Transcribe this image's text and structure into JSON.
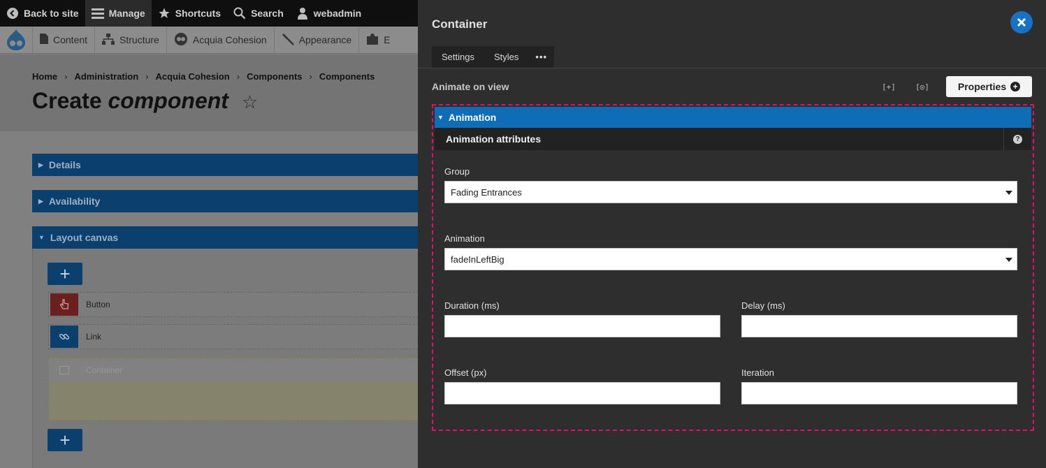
{
  "toolbar": {
    "back_label": "Back to site",
    "manage_label": "Manage",
    "shortcuts_label": "Shortcuts",
    "search_label": "Search",
    "user_label": "webadmin"
  },
  "tray": {
    "items": [
      "Content",
      "Structure",
      "Acquia Cohesion",
      "Appearance",
      "E"
    ]
  },
  "breadcrumb": [
    "Home",
    "Administration",
    "Acquia Cohesion",
    "Components",
    "Components"
  ],
  "page": {
    "title_plain": "Create",
    "title_italic": "component",
    "star": "☆"
  },
  "accordions": {
    "details": "Details",
    "availability": "Availability",
    "layout_canvas": "Layout canvas"
  },
  "canvas": {
    "add_symbol": "+",
    "button_label": "Button",
    "link_label": "Link",
    "container_label": "Container"
  },
  "panel": {
    "title": "Container",
    "tabs": [
      "Settings",
      "Styles",
      "•••"
    ],
    "animate_label": "Animate on view",
    "icon_expand": "[+]",
    "icon_preview": "[◎]",
    "properties_label": "Properties",
    "properties_plus": "+",
    "animation_header": "Animation",
    "attributes_header": "Animation attributes",
    "help_symbol": "?"
  },
  "form": {
    "group_label": "Group",
    "group_value": "Fading Entrances",
    "animation_label": "Animation",
    "animation_value": "fadeInLeftBig",
    "duration_label": "Duration (ms)",
    "delay_label": "Delay (ms)",
    "offset_label": "Offset (px)",
    "iteration_label": "Iteration"
  },
  "colors": {
    "panel_bg": "#2e2e2e",
    "accent_blue": "#0f6db8",
    "close_blue": "#1672c2",
    "frame_pink": "#e0106a",
    "button_red": "#8b1e1e"
  }
}
